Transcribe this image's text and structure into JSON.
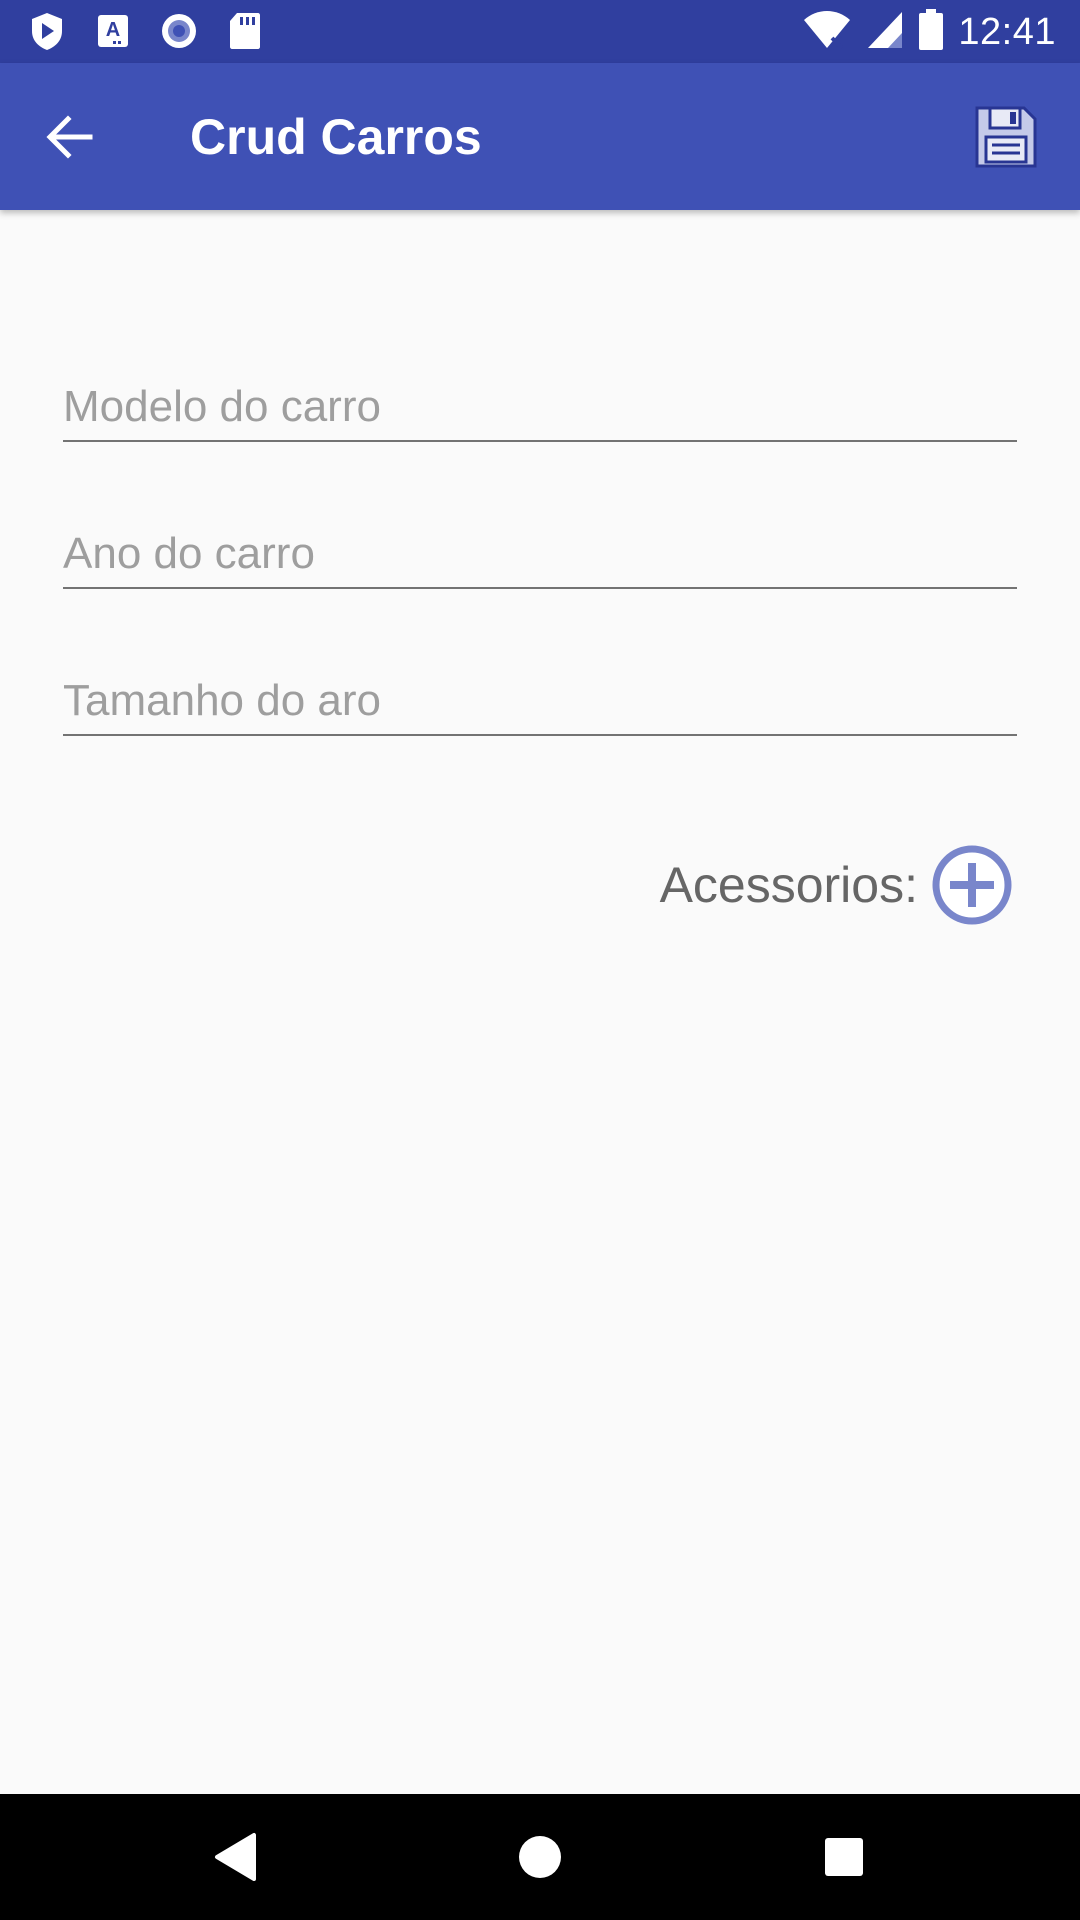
{
  "status_bar": {
    "time": "12:41",
    "icons": [
      "shield-play-icon",
      "font-a-icon",
      "record-icon",
      "sd-card-icon",
      "wifi-off-icon",
      "signal-icon",
      "battery-icon"
    ]
  },
  "app_bar": {
    "title": "Crud Carros",
    "back_icon": "arrow-left-icon",
    "save_icon": "floppy-disk-icon"
  },
  "form": {
    "modelo": {
      "placeholder": "Modelo do carro",
      "value": ""
    },
    "ano": {
      "placeholder": "Ano do carro",
      "value": ""
    },
    "aro": {
      "placeholder": "Tamanho do aro",
      "value": ""
    },
    "accessories_label": "Acessorios:",
    "add_icon": "plus-circle-icon"
  },
  "nav_bar": {
    "icons": [
      "nav-back-icon",
      "nav-home-icon",
      "nav-recent-icon"
    ]
  },
  "colors": {
    "status_bar": "#303f9f",
    "app_bar": "#3f51b5",
    "background": "#fafafa",
    "accent_icon": "#7986cb"
  }
}
